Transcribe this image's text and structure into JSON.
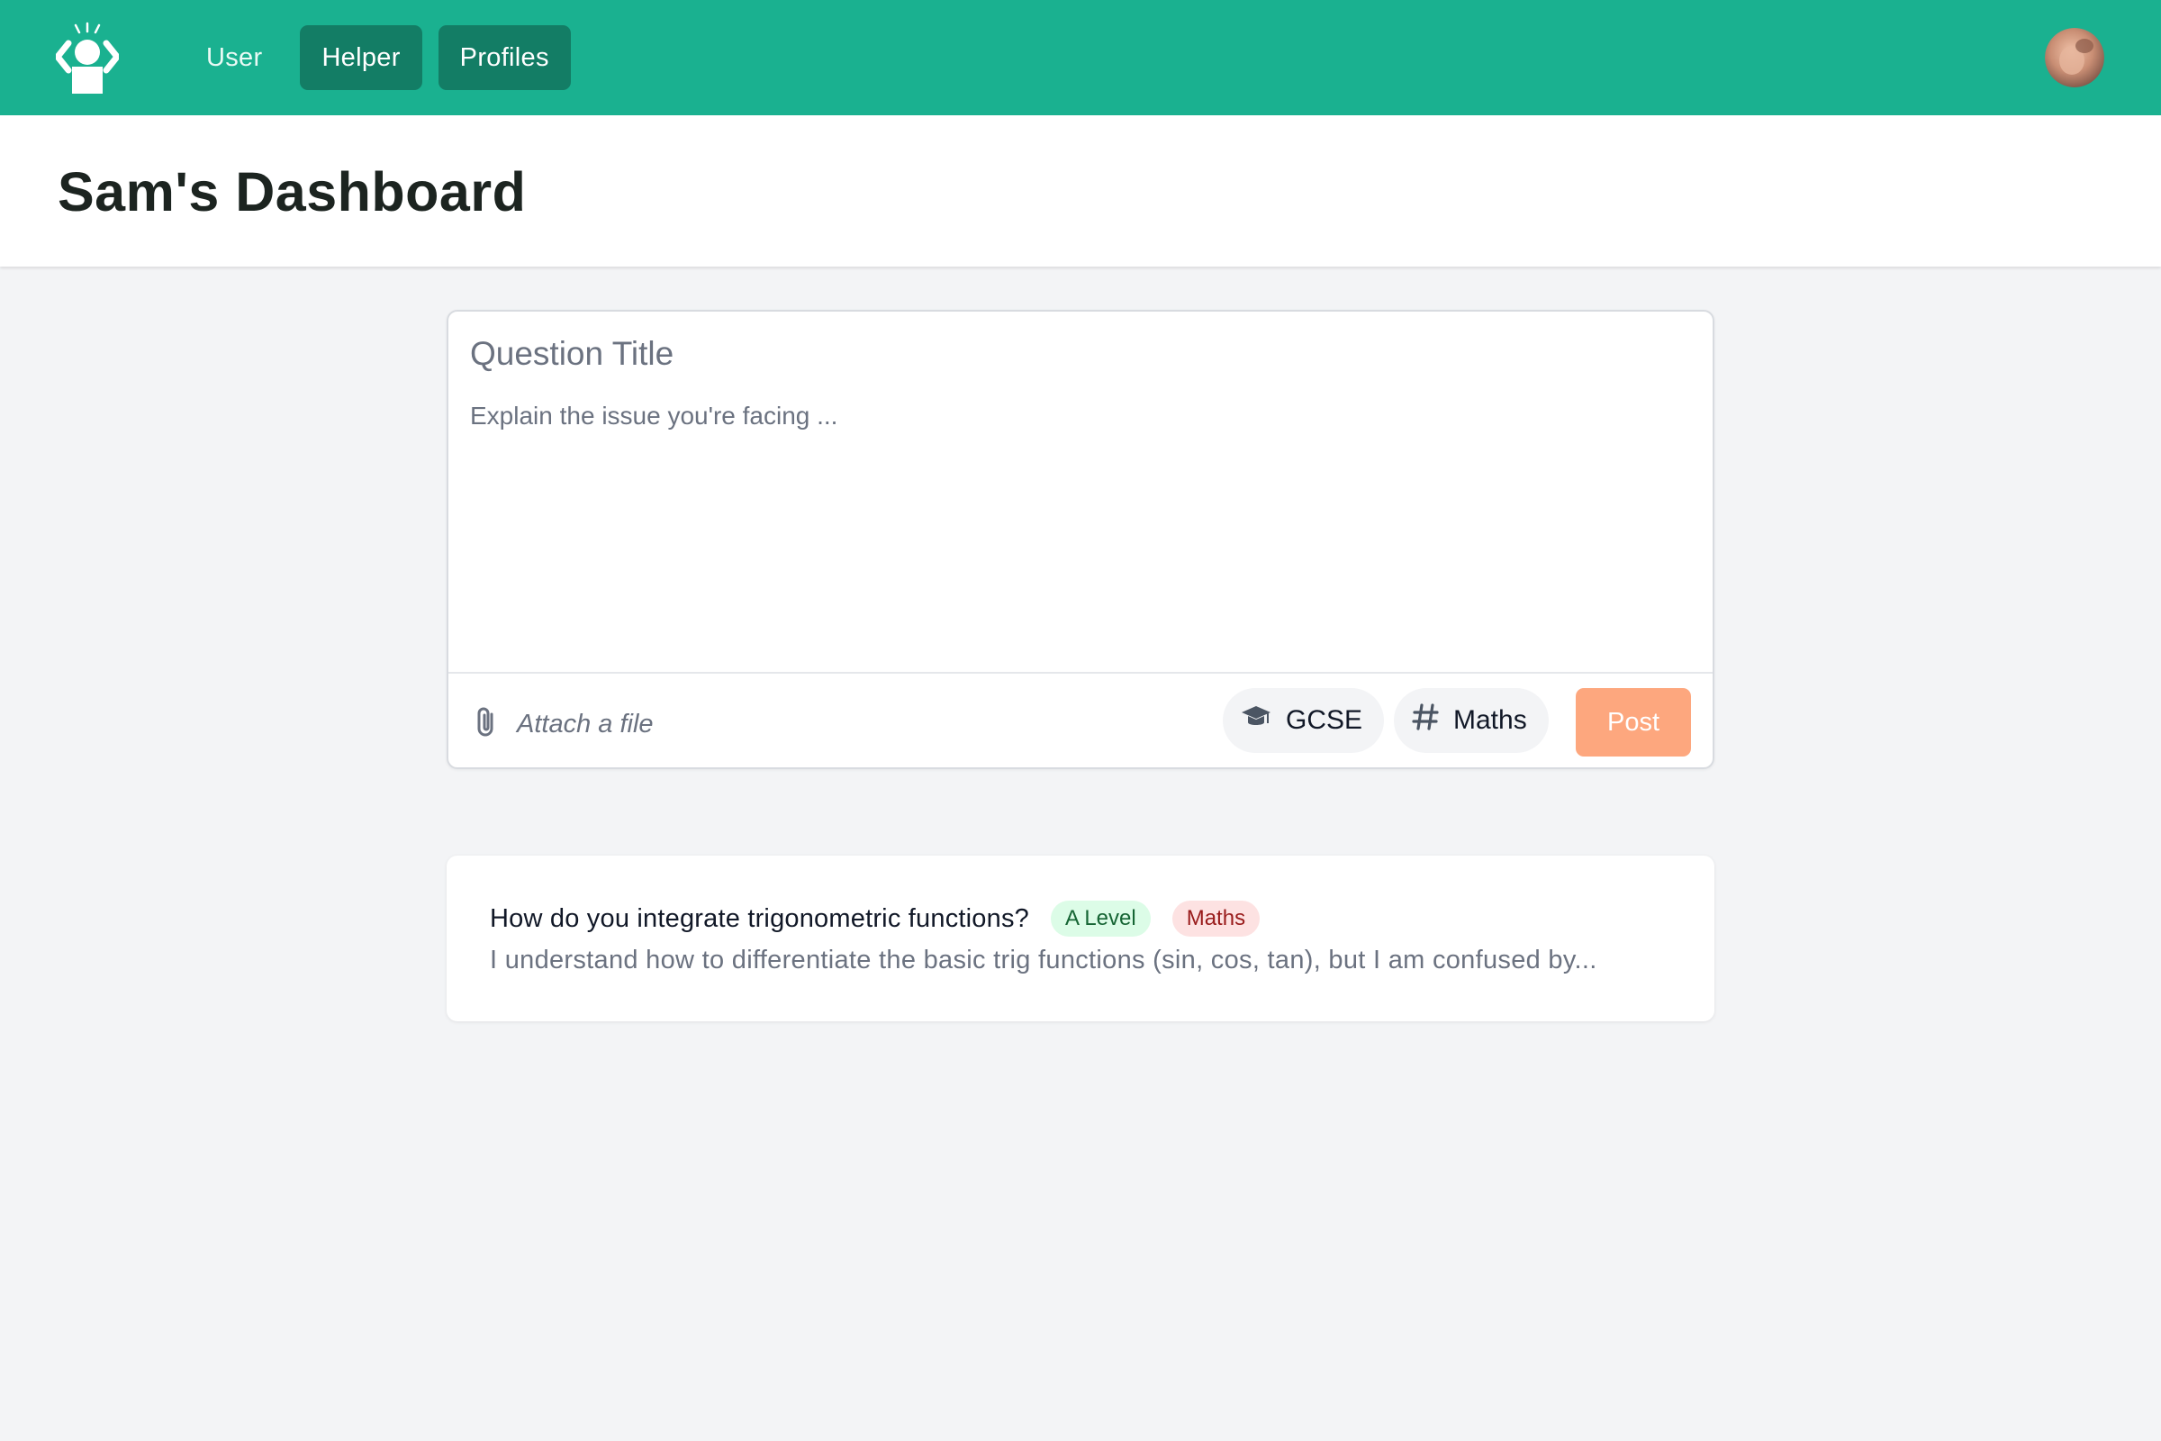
{
  "nav": {
    "logo_icon": "helper-logo-icon",
    "links": [
      {
        "label": "User",
        "active": false
      },
      {
        "label": "Helper",
        "active": true
      },
      {
        "label": "Profiles",
        "active": true
      }
    ],
    "avatar_icon": "user-avatar"
  },
  "header": {
    "title": "Sam's Dashboard"
  },
  "composer": {
    "title_placeholder": "Question Title",
    "body_placeholder": "Explain the issue you're facing ...",
    "attach_label": "Attach a file",
    "attach_icon": "paperclip-icon",
    "level_tag": {
      "label": "GCSE",
      "icon": "graduation-cap-icon"
    },
    "subject_tag": {
      "label": "Maths",
      "icon": "hashtag-icon"
    },
    "post_label": "Post"
  },
  "questions": [
    {
      "title": "How do you integrate trigonometric functions?",
      "level": "A Level",
      "subject": "Maths",
      "excerpt": "I understand how to differentiate the basic trig functions (sin, cos, tan), but I am confused by..."
    }
  ],
  "colors": {
    "brand": "#1ab190",
    "brand_dark": "#137d65",
    "post_button": "#fda77e",
    "page_bg": "#f3f4f6"
  }
}
